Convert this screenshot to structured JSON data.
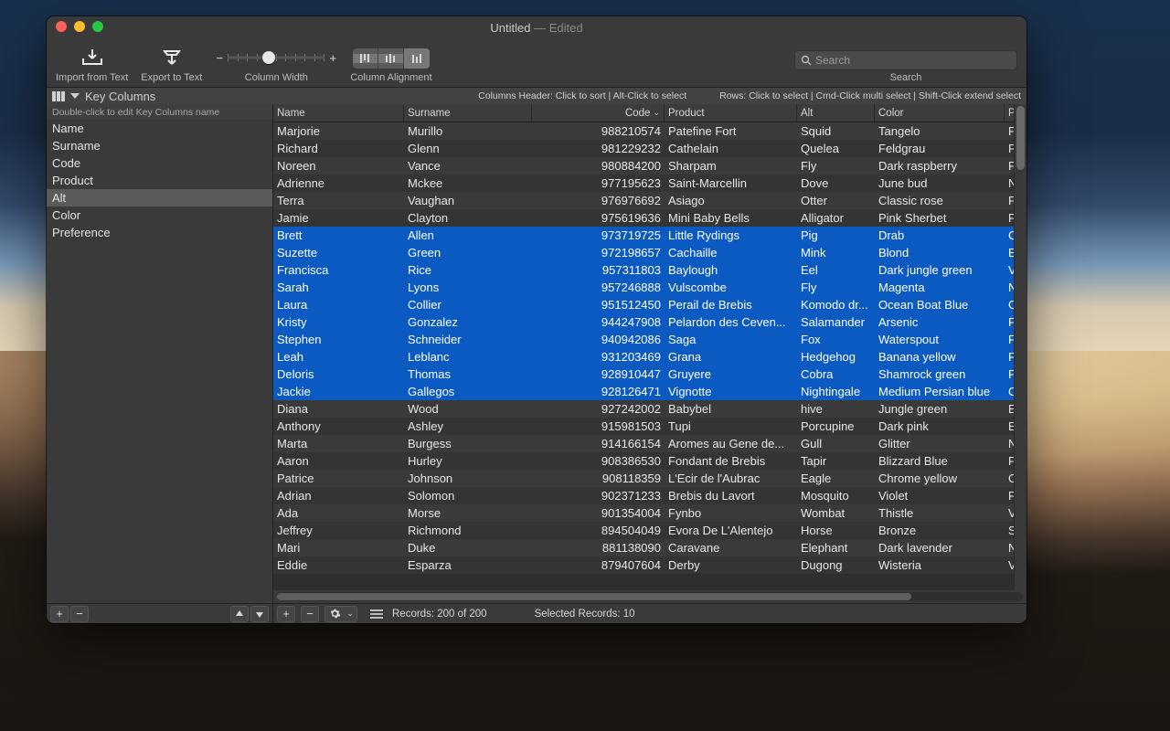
{
  "window": {
    "title": "Untitled",
    "subtitle": " — Edited"
  },
  "toolbar": {
    "import_label": "Import from Text",
    "export_label": "Export to Text",
    "width_label": "Column Width",
    "align_label": "Column Alignment",
    "search_placeholder": "Search",
    "search_label": "Search"
  },
  "hints": {
    "key_columns": "Key Columns",
    "sub": "Double-click to edit Key Columns name",
    "cols": "Columns Header: Click to sort | Alt-Click to select",
    "rows": "Rows: Click to select | Cmd-Click multi select   | Shift-Click extend select"
  },
  "sidebar": {
    "items": [
      "Name",
      "Surname",
      "Code",
      "Product",
      "Alt",
      "Color",
      "Preference"
    ],
    "selected": 4
  },
  "table": {
    "columns": [
      "Name",
      "Surname",
      "Code",
      "Product",
      "Alt",
      "Color",
      "P"
    ],
    "sort_col": 2,
    "rows": [
      {
        "sel": false,
        "v": [
          "Marjorie",
          "Murillo",
          "988210574",
          "Patefine Fort",
          "Squid",
          "Tangelo",
          "F"
        ]
      },
      {
        "sel": false,
        "v": [
          "Richard",
          "Glenn",
          "981229232",
          "Cathelain",
          "Quelea",
          "Feldgrau",
          "F"
        ]
      },
      {
        "sel": false,
        "v": [
          "Noreen",
          "Vance",
          "980884200",
          "Sharpam",
          "Fly",
          "Dark raspberry",
          "F"
        ]
      },
      {
        "sel": false,
        "v": [
          "Adrienne",
          "Mckee",
          "977195623",
          "Saint-Marcellin",
          "Dove",
          "June bud",
          "N"
        ]
      },
      {
        "sel": false,
        "v": [
          "Terra",
          "Vaughan",
          "976976692",
          "Asiago",
          "Otter",
          "Classic rose",
          "F"
        ]
      },
      {
        "sel": false,
        "v": [
          "Jamie",
          "Clayton",
          "975619636",
          "Mini Baby Bells",
          "Alligator",
          "Pink Sherbet",
          "F"
        ]
      },
      {
        "sel": true,
        "v": [
          "Brett",
          "Allen",
          "973719725",
          "Little Rydings",
          "Pig",
          "Drab",
          "C"
        ]
      },
      {
        "sel": true,
        "v": [
          "Suzette",
          "Green",
          "972198657",
          "Cachaille",
          "Mink",
          "Blond",
          "E"
        ]
      },
      {
        "sel": true,
        "v": [
          "Francisca",
          "Rice",
          "957311803",
          "Baylough",
          "Eel",
          "Dark jungle green",
          "V"
        ]
      },
      {
        "sel": true,
        "v": [
          "Sarah",
          "Lyons",
          "957246888",
          "Vulscombe",
          "Fly",
          "Magenta",
          "N"
        ]
      },
      {
        "sel": true,
        "v": [
          "Laura",
          "Collier",
          "951512450",
          "Perail de Brebis",
          "Komodo dr...",
          "Ocean Boat Blue",
          "C"
        ]
      },
      {
        "sel": true,
        "v": [
          "Kristy",
          "Gonzalez",
          "944247908",
          "Pelardon des Ceven...",
          "Salamander",
          "Arsenic",
          "F"
        ]
      },
      {
        "sel": true,
        "v": [
          "Stephen",
          "Schneider",
          "940942086",
          "Saga",
          "Fox",
          "Waterspout",
          "F"
        ]
      },
      {
        "sel": true,
        "v": [
          "Leah",
          "Leblanc",
          "931203469",
          "Grana",
          "Hedgehog",
          "Banana yellow",
          "F"
        ]
      },
      {
        "sel": true,
        "v": [
          "Deloris",
          "Thomas",
          "928910447",
          "Gruyere",
          "Cobra",
          "Shamrock green",
          "F"
        ]
      },
      {
        "sel": true,
        "v": [
          "Jackie",
          "Gallegos",
          "928126471",
          "Vignotte",
          "Nightingale",
          "Medium Persian blue",
          "C"
        ]
      },
      {
        "sel": false,
        "v": [
          "Diana",
          "Wood",
          "927242002",
          "Babybel",
          "hive",
          "Jungle green",
          "E"
        ]
      },
      {
        "sel": false,
        "v": [
          "Anthony",
          "Ashley",
          "915981503",
          "Tupi",
          "Porcupine",
          "Dark pink",
          "E"
        ]
      },
      {
        "sel": false,
        "v": [
          "Marta",
          "Burgess",
          "914166154",
          "Aromes au Gene de...",
          "Gull",
          "Glitter",
          "N"
        ]
      },
      {
        "sel": false,
        "v": [
          "Aaron",
          "Hurley",
          "908386530",
          "Fondant de Brebis",
          "Tapir",
          "Blizzard Blue",
          "F"
        ]
      },
      {
        "sel": false,
        "v": [
          "Patrice",
          "Johnson",
          "908118359",
          "L'Ecir de l'Aubrac",
          "Eagle",
          "Chrome yellow",
          "C"
        ]
      },
      {
        "sel": false,
        "v": [
          "Adrian",
          "Solomon",
          "902371233",
          "Brebis du Lavort",
          "Mosquito",
          "Violet",
          "F"
        ]
      },
      {
        "sel": false,
        "v": [
          "Ada",
          "Morse",
          "901354004",
          "Fynbo",
          "Wombat",
          "Thistle",
          "V"
        ]
      },
      {
        "sel": false,
        "v": [
          "Jeffrey",
          "Richmond",
          "894504049",
          "Evora De L'Alentejo",
          "Horse",
          "Bronze",
          "S"
        ]
      },
      {
        "sel": false,
        "v": [
          "Mari",
          "Duke",
          "881138090",
          "Caravane",
          "Elephant",
          "Dark lavender",
          "N"
        ]
      },
      {
        "sel": false,
        "v": [
          "Eddie",
          "Esparza",
          "879407604",
          "Derby",
          "Dugong",
          "Wisteria",
          "V"
        ]
      }
    ]
  },
  "footer": {
    "records": "Records: 200 of 200",
    "selected": "Selected Records: 10"
  }
}
